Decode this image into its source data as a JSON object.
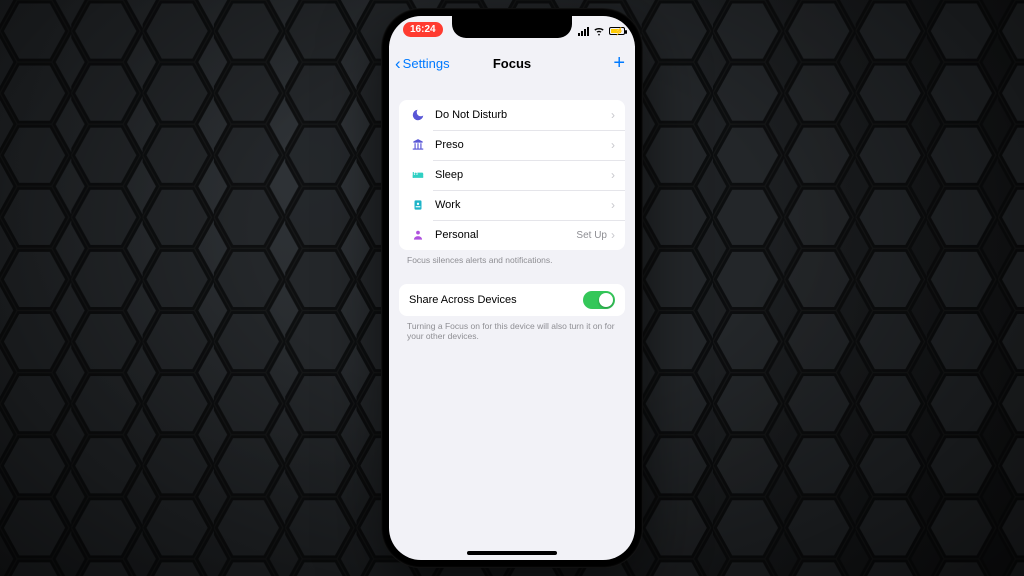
{
  "statusbar": {
    "time": "16:24"
  },
  "navbar": {
    "back_label": "Settings",
    "title": "Focus"
  },
  "modes": {
    "dnd": {
      "label": "Do Not Disturb",
      "detail": ""
    },
    "preso": {
      "label": "Preso",
      "detail": ""
    },
    "sleep": {
      "label": "Sleep",
      "detail": ""
    },
    "work": {
      "label": "Work",
      "detail": ""
    },
    "personal": {
      "label": "Personal",
      "detail": "Set Up"
    }
  },
  "notes": {
    "modes": "Focus silences alerts and notifications.",
    "share": "Turning a Focus on for this device will also turn it on for your other devices."
  },
  "share": {
    "label": "Share Across Devices",
    "enabled": true
  },
  "colors": {
    "accent": "#007aff",
    "switch_on": "#34c759",
    "time_badge": "#ff3b30"
  }
}
